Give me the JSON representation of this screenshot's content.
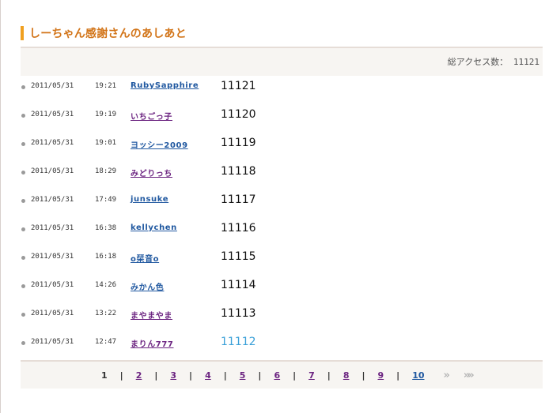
{
  "heading": {
    "title": "しーちゃん感謝さんのあしあと"
  },
  "access": {
    "label": "総アクセス数：",
    "value": "11121"
  },
  "visits": [
    {
      "date": "2011/05/31",
      "time": "19:21",
      "user": "RubySapphire",
      "count": "11121"
    },
    {
      "date": "2011/05/31",
      "time": "19:19",
      "user": "いちごっ子",
      "count": "11120"
    },
    {
      "date": "2011/05/31",
      "time": "19:01",
      "user": "ヨッシー2009",
      "count": "11119"
    },
    {
      "date": "2011/05/31",
      "time": "18:29",
      "user": "みどりっち",
      "count": "11118"
    },
    {
      "date": "2011/05/31",
      "time": "17:49",
      "user": "junsuke",
      "count": "11117"
    },
    {
      "date": "2011/05/31",
      "time": "16:38",
      "user": "kellychen",
      "count": "11116"
    },
    {
      "date": "2011/05/31",
      "time": "16:18",
      "user": "o栞音o",
      "count": "11115"
    },
    {
      "date": "2011/05/31",
      "time": "14:26",
      "user": "みかん色",
      "count": "11114"
    },
    {
      "date": "2011/05/31",
      "time": "13:22",
      "user": "まやまやま",
      "count": "11113"
    },
    {
      "date": "2011/05/31",
      "time": "12:47",
      "user": "まりん777",
      "count": "11112"
    }
  ],
  "pagination": {
    "current": "1",
    "pages": [
      "2",
      "3",
      "4",
      "5",
      "6",
      "7",
      "8",
      "9",
      "10"
    ],
    "separator": "|",
    "next": "»",
    "last": "»»"
  },
  "colors": {
    "heading": "#d27418",
    "accent_bar": "#f0a020",
    "link_blue": "#2058a0",
    "link_purple": "#6b2380",
    "highlight_count": "#3aa0d8"
  }
}
